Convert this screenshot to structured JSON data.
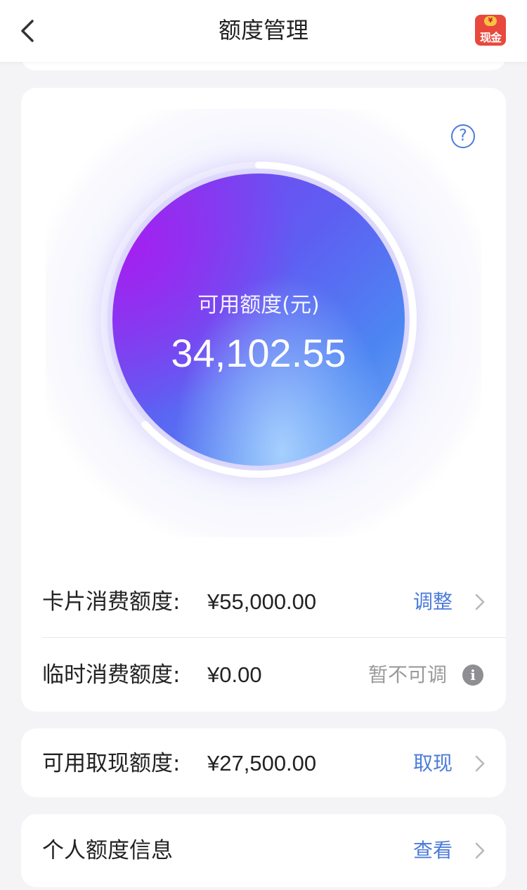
{
  "header": {
    "title": "额度管理",
    "cash_badge": "现金",
    "cash_coin": "¥"
  },
  "gauge": {
    "label": "可用额度(元)",
    "value": "34,102.55",
    "help_symbol": "?"
  },
  "limits": {
    "card": {
      "label": "卡片消费额度:",
      "value": "¥55,000.00",
      "action": "调整"
    },
    "temp": {
      "label": "临时消费额度:",
      "value": "¥0.00",
      "status": "暂不可调",
      "info_symbol": "i"
    }
  },
  "withdraw": {
    "label": "可用取现额度:",
    "value": "¥27,500.00",
    "action": "取现"
  },
  "personal": {
    "label": "个人额度信息",
    "action": "查看"
  },
  "colors": {
    "link": "#4b7bd9",
    "muted": "#9a9a9a",
    "orb_start": "#a420f0",
    "orb_end": "#74a8f4"
  },
  "icons": [
    "back-arrow-icon",
    "cash-badge-icon",
    "help-icon",
    "chevron-right-icon",
    "info-icon"
  ]
}
